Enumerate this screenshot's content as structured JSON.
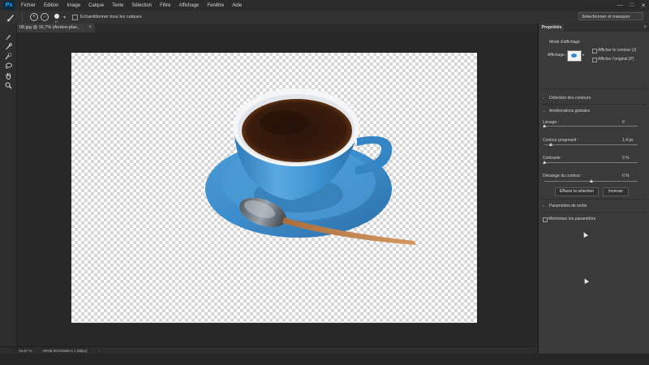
{
  "menubar": {
    "logo": "Ps",
    "items": [
      "Fichier",
      "Edition",
      "Image",
      "Calque",
      "Texte",
      "Sélection",
      "Filtre",
      "Affichage",
      "Fenêtre",
      "Aide"
    ],
    "window_controls": [
      "—",
      "□",
      "✕"
    ]
  },
  "options_bar": {
    "brush_size": "10",
    "sample_all_layers_label": "Echantillonner tous les calques",
    "sample_all_layers_checked": false,
    "select_mask_button": "Sélectionner et masquer"
  },
  "document_tab": {
    "title": "08.jpg @ 16,7% (Arrière-plan, RVB/8*)",
    "close": "×"
  },
  "tools": [
    "brush-icon",
    "refine-edge-brush-icon",
    "quick-selection-icon",
    "lasso-icon",
    "hand-icon",
    "zoom-icon"
  ],
  "status_bar": {
    "zoom": "16,67 %",
    "profile": "sRGB IEC61966-2.1 (8bpc)",
    "arrow": "›"
  },
  "properties_panel": {
    "tab_label": "Propriétés",
    "close": "×",
    "view_mode_heading": "Mode d'affichage",
    "view_label": "Affichage :",
    "show_edge_label": "Afficher le contour (J)",
    "show_original_label": "Afficher l'original (P)",
    "edge_detection_label": "Détection des contours",
    "global_refinements_label": "Améliorations globales",
    "smooth_label": "Lissage :",
    "smooth_value": "0",
    "feather_label": "Contour progressif :",
    "feather_value": "1,4 px",
    "contrast_label": "Contraste :",
    "contrast_value": "0 %",
    "shift_edge_label": "Décalage du contour :",
    "shift_edge_value": "0 %",
    "clear_selection_button": "Effacer la sélection",
    "invert_button": "Inverser",
    "output_settings_label": "Paramètres de sortie",
    "remember_settings_label": "Mémoriser les paramètres",
    "sliders": {
      "smooth": 0.0,
      "feather": 0.07,
      "contrast": 0.0,
      "shift_edge": 0.5
    }
  },
  "colors": {
    "app_bg": "#282828",
    "panel_bg": "#3a3a3a",
    "accent": "#31a8ff",
    "cup_blue": "#3a8fcf",
    "coffee": "#2c160c"
  }
}
